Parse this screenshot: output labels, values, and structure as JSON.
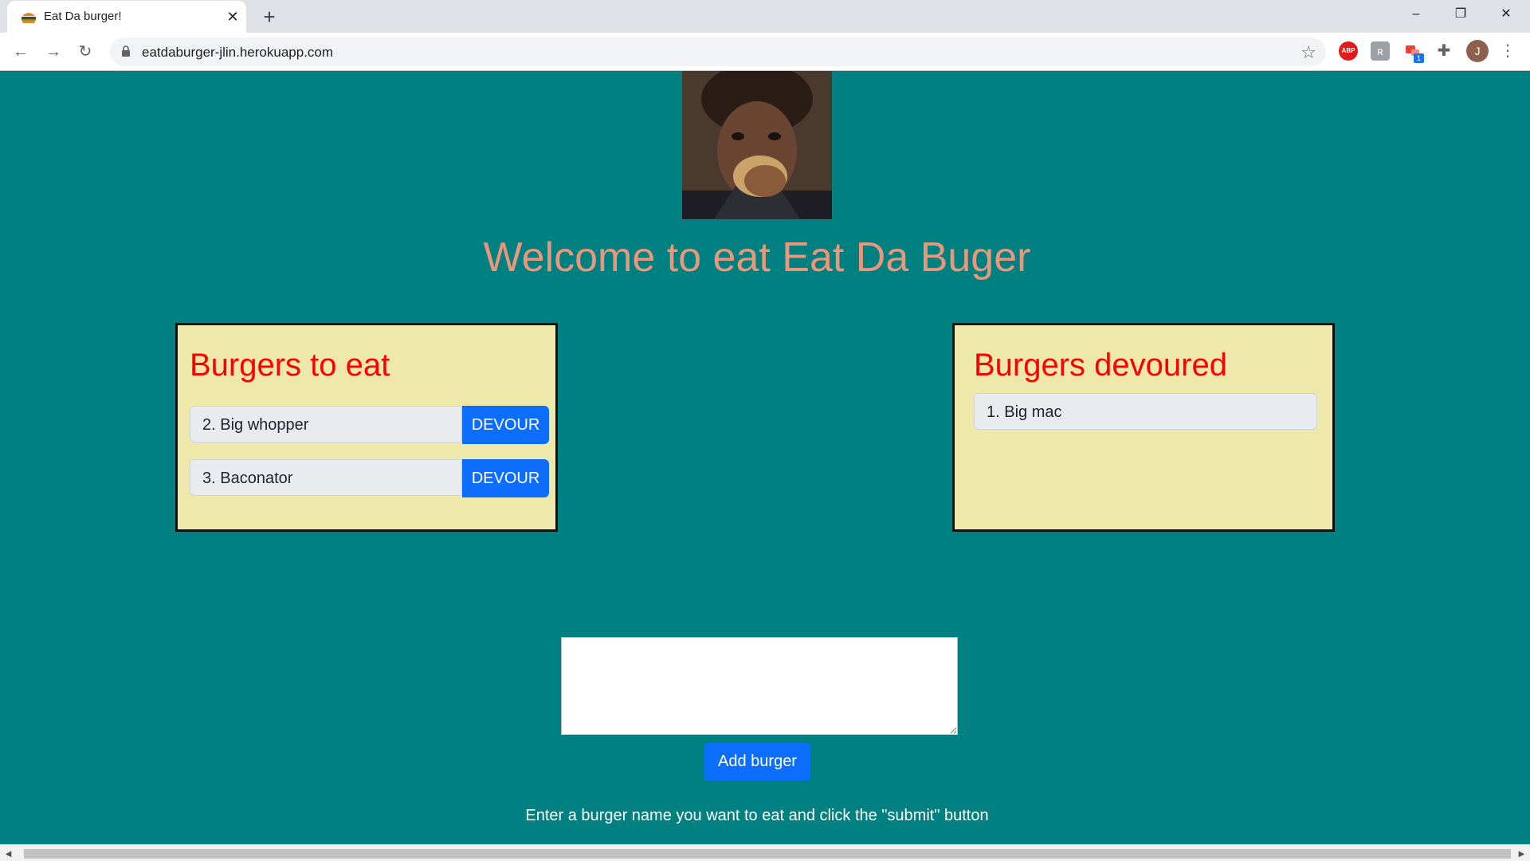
{
  "browser": {
    "tab_title": "Eat Da burger!",
    "tab_close": "✕",
    "new_tab": "+",
    "url": "eatdaburger-jlin.herokuapp.com",
    "avatar_initial": "J",
    "extension_badge": "1",
    "abp_label": "ABP",
    "icons": [
      "burger-favicon",
      "back-icon",
      "forward-icon",
      "reload-icon",
      "lock-icon",
      "star-icon",
      "adblock-icon",
      "extension-icon",
      "puzzle-icon",
      "menu-icon"
    ]
  },
  "page": {
    "title": "Welcome to eat Eat Da Buger",
    "to_eat": {
      "heading": "Burgers to eat",
      "items": [
        {
          "name": "2. Big whopper",
          "action": "DEVOUR"
        },
        {
          "name": "3. Baconator",
          "action": "DEVOUR"
        }
      ]
    },
    "devoured": {
      "heading": "Burgers devoured",
      "items": [
        {
          "name": "1. Big mac"
        }
      ]
    },
    "form": {
      "input_value": "",
      "add_button": "Add burger",
      "instructions": "Enter a burger name you want to eat and click the \"submit\" button"
    }
  },
  "colors": {
    "background": "#008080",
    "title": "#e9967a",
    "panel": "#eee8aa",
    "heading": "#ff0000",
    "button": "#0d6efd"
  }
}
